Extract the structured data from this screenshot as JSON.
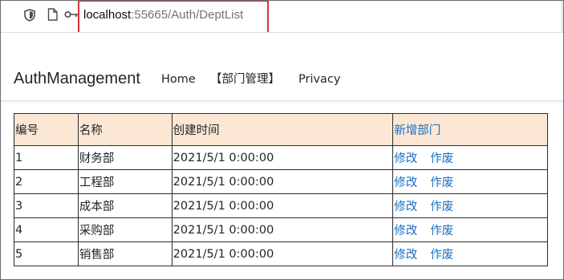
{
  "browser": {
    "url_host": "localhost",
    "url_rest": ":55665/Auth/DeptList",
    "icons": [
      "shield-icon",
      "page-icon",
      "key-icon"
    ],
    "highlight_color": "#d9303a"
  },
  "navbar": {
    "brand": "AuthManagement",
    "links": [
      {
        "label": "Home"
      },
      {
        "label": "【部门管理】"
      },
      {
        "label": "Privacy"
      }
    ]
  },
  "table": {
    "header_bg": "#fbe7d3",
    "link_color": "#1a6fc4",
    "headers": {
      "id": "编号",
      "name": "名称",
      "created": "创建时间",
      "add_link": "新增部门"
    },
    "rows": [
      {
        "id": "1",
        "name": "财务部",
        "created": "2021/5/1 0:00:00",
        "edit": "修改",
        "disable": "作废"
      },
      {
        "id": "2",
        "name": "工程部",
        "created": "2021/5/1 0:00:00",
        "edit": "修改",
        "disable": "作废"
      },
      {
        "id": "3",
        "name": "成本部",
        "created": "2021/5/1 0:00:00",
        "edit": "修改",
        "disable": "作废"
      },
      {
        "id": "4",
        "name": "采购部",
        "created": "2021/5/1 0:00:00",
        "edit": "修改",
        "disable": "作废"
      },
      {
        "id": "5",
        "name": "销售部",
        "created": "2021/5/1 0:00:00",
        "edit": "修改",
        "disable": "作废"
      }
    ]
  }
}
